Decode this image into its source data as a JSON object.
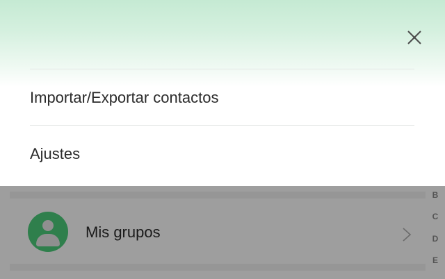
{
  "menu": {
    "items": [
      {
        "label": "Importar/Exportar contactos"
      },
      {
        "label": "Ajustes"
      }
    ],
    "close_icon": "close-icon"
  },
  "contacts": {
    "group_row": {
      "label": "Mis grupos",
      "avatar_icon": "group-avatar-icon",
      "chevron_icon": "chevron-right-icon"
    },
    "index_letters": [
      "B",
      "C",
      "D",
      "E"
    ]
  },
  "colors": {
    "accent_green": "#2f7f4c",
    "header_tint": "#c5ead3",
    "scrim": "#9e9e9e"
  }
}
